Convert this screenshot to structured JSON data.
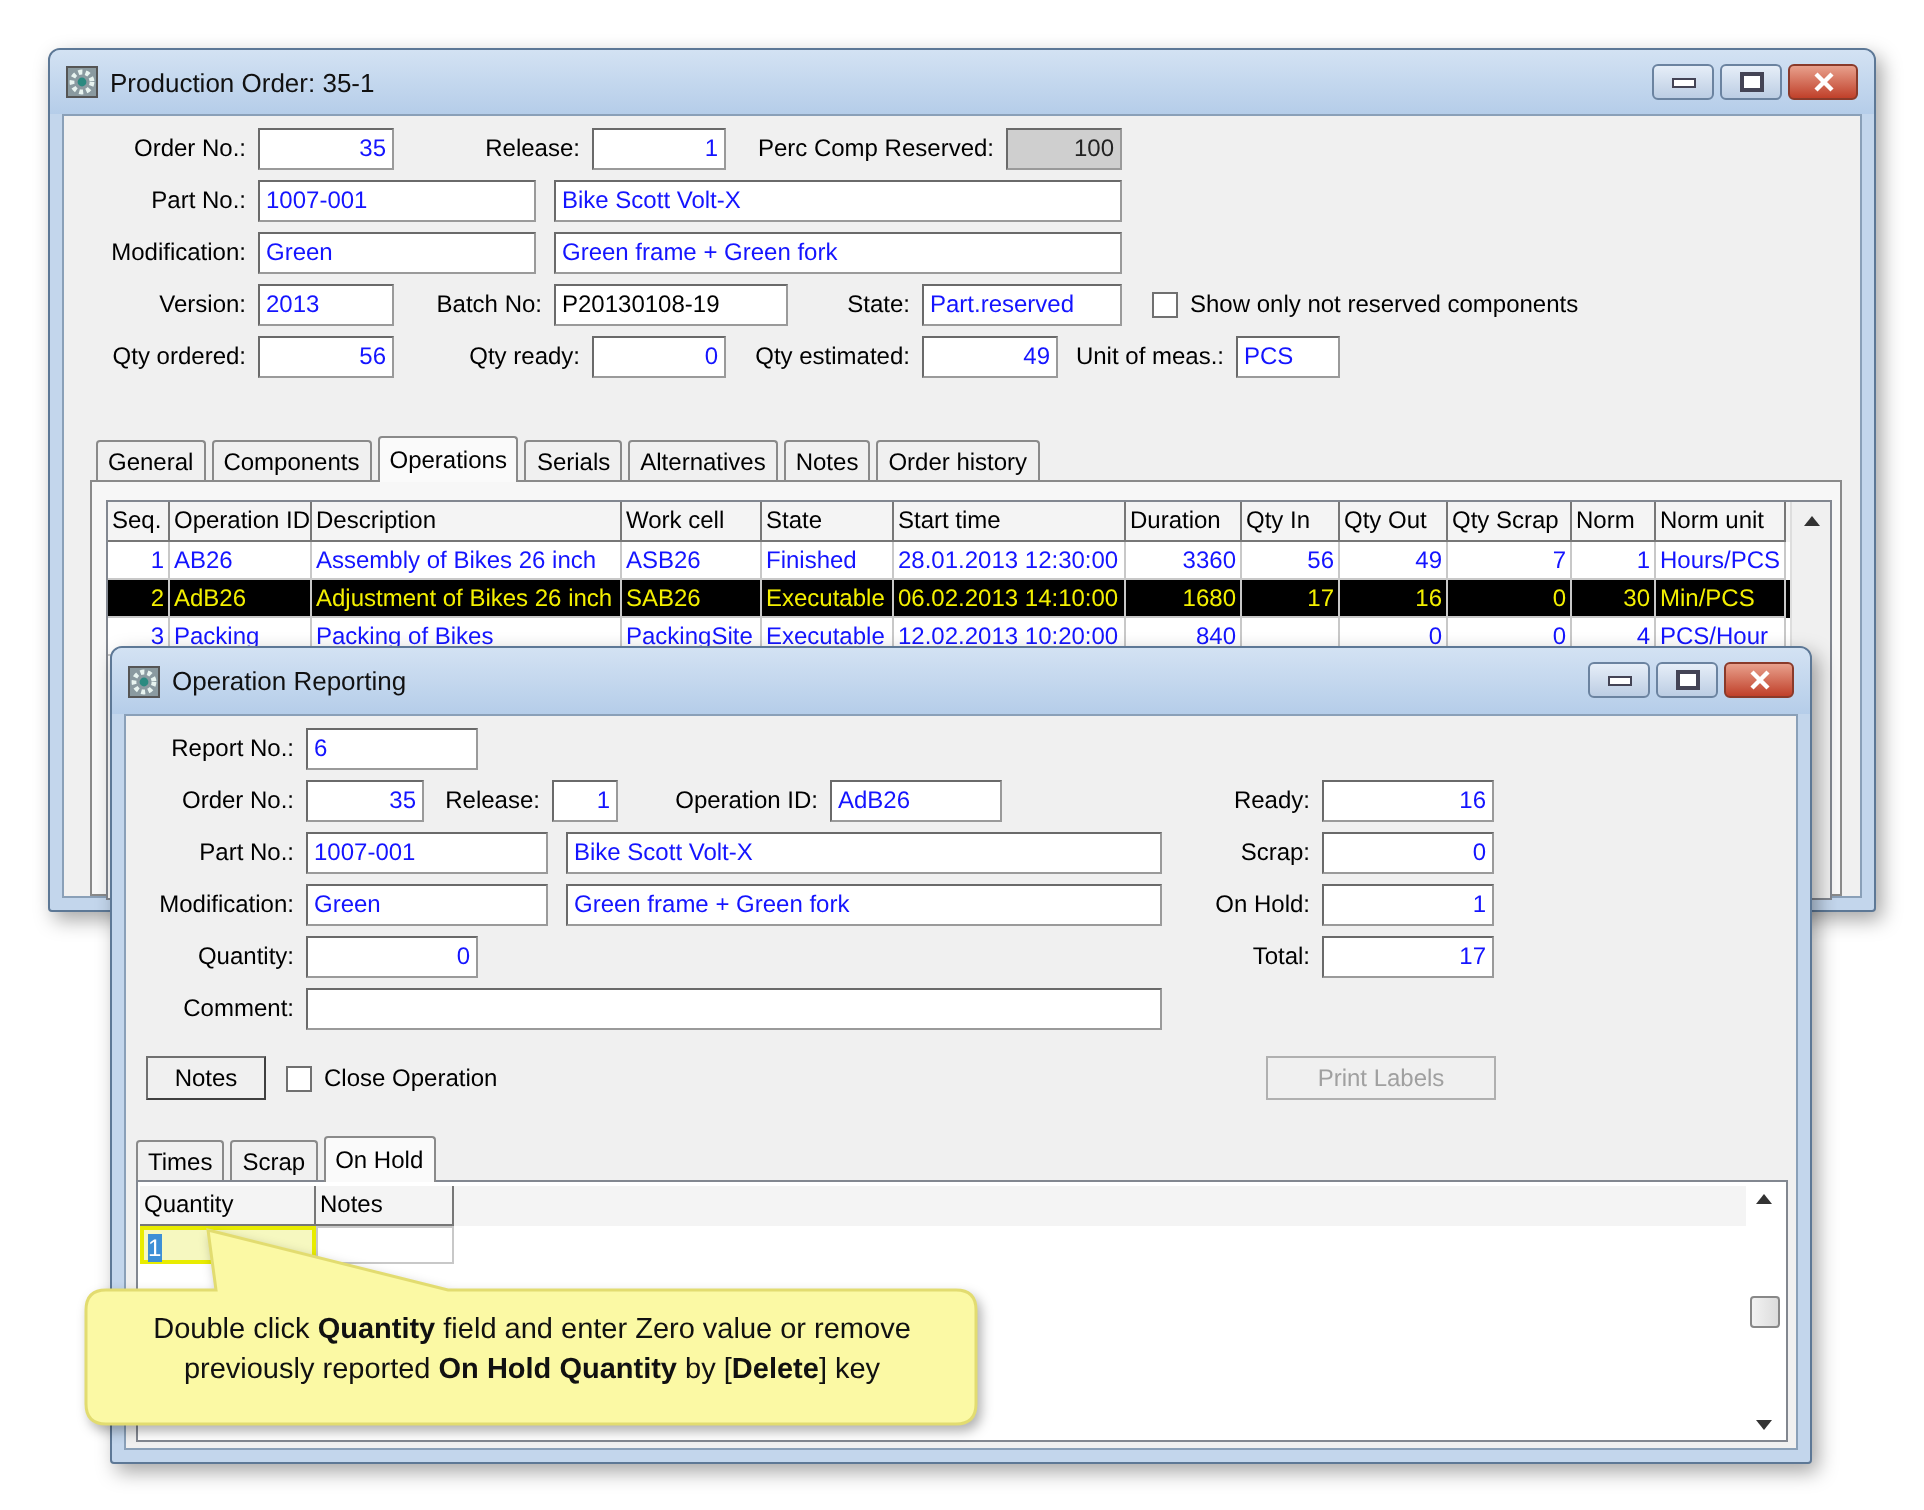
{
  "production_order": {
    "title": "Production Order: 35-1",
    "order_no": {
      "label": "Order No.:",
      "value": "35"
    },
    "release": {
      "label": "Release:",
      "value": "1"
    },
    "perc_comp_reserved": {
      "label": "Perc Comp Reserved:",
      "value": "100",
      "readonly": true
    },
    "part_no": {
      "label": "Part No.:",
      "value": "1007-001"
    },
    "part_description": {
      "value": "Bike Scott Volt-X"
    },
    "modification": {
      "label": "Modification:",
      "value": "Green"
    },
    "modification_description": {
      "value": "Green frame + Green fork"
    },
    "version": {
      "label": "Version:",
      "value": "2013"
    },
    "batch_no": {
      "label": "Batch No:",
      "value": "P20130108-19"
    },
    "state": {
      "label": "State:",
      "value": "Part.reserved"
    },
    "show_only_not_reserved": {
      "label": "Show only not reserved components",
      "checked": false
    },
    "qty_ordered": {
      "label": "Qty ordered:",
      "value": "56"
    },
    "qty_ready": {
      "label": "Qty ready:",
      "value": "0"
    },
    "qty_estimated": {
      "label": "Qty estimated:",
      "value": "49"
    },
    "unit_of_meas": {
      "label": "Unit of meas.:",
      "value": "PCS"
    },
    "tabs": [
      {
        "label": "General",
        "selected": false
      },
      {
        "label": "Components",
        "selected": false
      },
      {
        "label": "Operations",
        "selected": true
      },
      {
        "label": "Serials",
        "selected": false
      },
      {
        "label": "Alternatives",
        "selected": false
      },
      {
        "label": "Notes",
        "selected": false
      },
      {
        "label": "Order history",
        "selected": false
      }
    ],
    "operations": {
      "columns": [
        "Seq.",
        "Operation ID",
        "Description",
        "Work cell",
        "State",
        "Start time",
        "Duration",
        "Qty In",
        "Qty Out",
        "Qty Scrap",
        "Norm",
        "Norm unit"
      ],
      "rows": [
        {
          "selected": false,
          "cells": [
            "1",
            "AB26",
            "Assembly of Bikes 26 inch",
            "ASB26",
            "Finished",
            "28.01.2013 12:30:00",
            "3360",
            "56",
            "49",
            "7",
            "1",
            "Hours/PCS"
          ]
        },
        {
          "selected": true,
          "cells": [
            "2",
            "AdB26",
            "Adjustment of Bikes 26 inch",
            "SAB26",
            "Executable",
            "06.02.2013 14:10:00",
            "1680",
            "17",
            "16",
            "0",
            "30",
            "Min/PCS"
          ]
        },
        {
          "selected": false,
          "cells": [
            "3",
            "Packing",
            "Packing of Bikes",
            "PackingSite",
            "Executable",
            "12.02.2013 10:20:00",
            "840",
            null,
            "0",
            "0",
            "4",
            "PCS/Hour"
          ]
        }
      ]
    }
  },
  "operation_reporting": {
    "title": "Operation Reporting",
    "report_no": {
      "label": "Report No.:",
      "value": "6"
    },
    "order_no": {
      "label": "Order No.:",
      "value": "35"
    },
    "release": {
      "label": "Release:",
      "value": "1"
    },
    "operation_id": {
      "label": "Operation ID:",
      "value": "AdB26"
    },
    "part_no": {
      "label": "Part No.:",
      "value": "1007-001"
    },
    "part_description": {
      "value": "Bike Scott Volt-X"
    },
    "modification": {
      "label": "Modification:",
      "value": "Green"
    },
    "modification_description": {
      "value": "Green frame + Green fork"
    },
    "quantity": {
      "label": "Quantity:",
      "value": "0"
    },
    "comment": {
      "label": "Comment:"
    },
    "ready": {
      "label": "Ready:",
      "value": "16"
    },
    "scrap": {
      "label": "Scrap:",
      "value": "0"
    },
    "on_hold": {
      "label": "On Hold:",
      "value": "1"
    },
    "total": {
      "label": "Total:",
      "value": "17"
    },
    "notes_button": {
      "label": "Notes"
    },
    "close_operation": {
      "label": "Close Operation",
      "checked": false
    },
    "print_labels": {
      "label": "Print Labels",
      "disabled": true
    },
    "tabs": [
      {
        "label": "Times",
        "selected": false
      },
      {
        "label": "Scrap",
        "selected": false
      },
      {
        "label": "On Hold",
        "selected": true
      }
    ],
    "on_hold_grid": {
      "columns": [
        "Quantity",
        "Notes"
      ],
      "rows": [
        {
          "selected": true,
          "cells": [
            "1",
            null
          ]
        }
      ]
    }
  },
  "callout": {
    "text": "Double click **Quantity** field and enter Zero value or remove previously reported **On Hold Quantity** by [**Delete**] key"
  }
}
